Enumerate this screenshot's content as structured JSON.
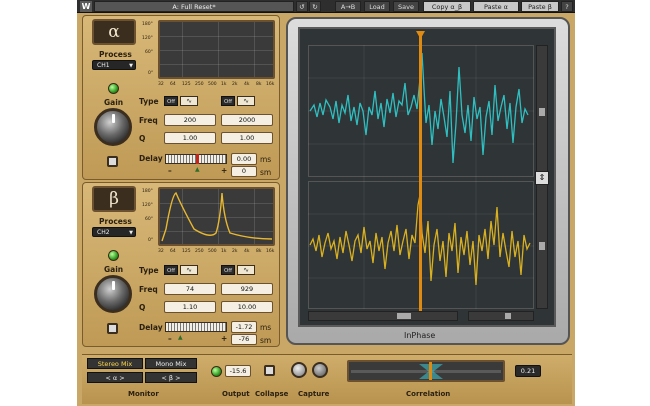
{
  "toolbar": {
    "logo": "W",
    "preset": "A: Full Reset*",
    "undo": "↺",
    "redo": "↻",
    "ab": "A→B",
    "load": "Load",
    "save": "Save",
    "copy": "Copy α_β",
    "paste_a": "Paste α",
    "paste_b": "Paste β",
    "help": "?"
  },
  "alpha": {
    "symbol": "α",
    "process_label": "Process",
    "process_value": "CH1",
    "gain_label": "Gain",
    "type_label": "Type",
    "off1": "Off",
    "off2": "Off",
    "freq_label": "Freq",
    "freq1": "200",
    "freq2": "2000",
    "q_label": "Q",
    "q1": "1.00",
    "q2": "1.00",
    "delay_label": "Delay",
    "delay_ms": "0.00",
    "delay_sm": "0",
    "ms": "ms",
    "sm": "sm",
    "minus": "–",
    "plus": "+"
  },
  "beta": {
    "symbol": "β",
    "process_label": "Process",
    "process_value": "CH2",
    "gain_label": "Gain",
    "type_label": "Type",
    "off1": "Off",
    "off2": "Off",
    "freq_label": "Freq",
    "freq1": "74",
    "freq2": "929",
    "q_label": "Q",
    "q1": "1.10",
    "q2": "10.00",
    "delay_label": "Delay",
    "delay_ms": "-1.72",
    "delay_sm": "-76",
    "ms": "ms",
    "sm": "sm",
    "minus": "–",
    "plus": "+"
  },
  "axis": {
    "y": [
      "180°",
      "120°",
      "60°",
      "0°"
    ],
    "x": [
      "32",
      "64",
      "125",
      "250",
      "500",
      "1k",
      "2k",
      "4k",
      "8k",
      "16k"
    ]
  },
  "scope": {
    "brand": "InPhase"
  },
  "bottom": {
    "stereo_mix": "Stereo Mix",
    "mono_mix": "Mono Mix",
    "alpha_mode": "< α >",
    "beta_mode": "< β >",
    "monitor_label": "Monitor",
    "output_value": "-15.6",
    "output_label": "Output",
    "collapse_label": "Collapse",
    "capture_label": "Capture",
    "correlation_label": "Correlation",
    "correlation_value": "0.21"
  },
  "colors": {
    "alpha_trace": "#2fbfc0",
    "beta_trace": "#d8b020",
    "cursor": "#e08a10"
  }
}
